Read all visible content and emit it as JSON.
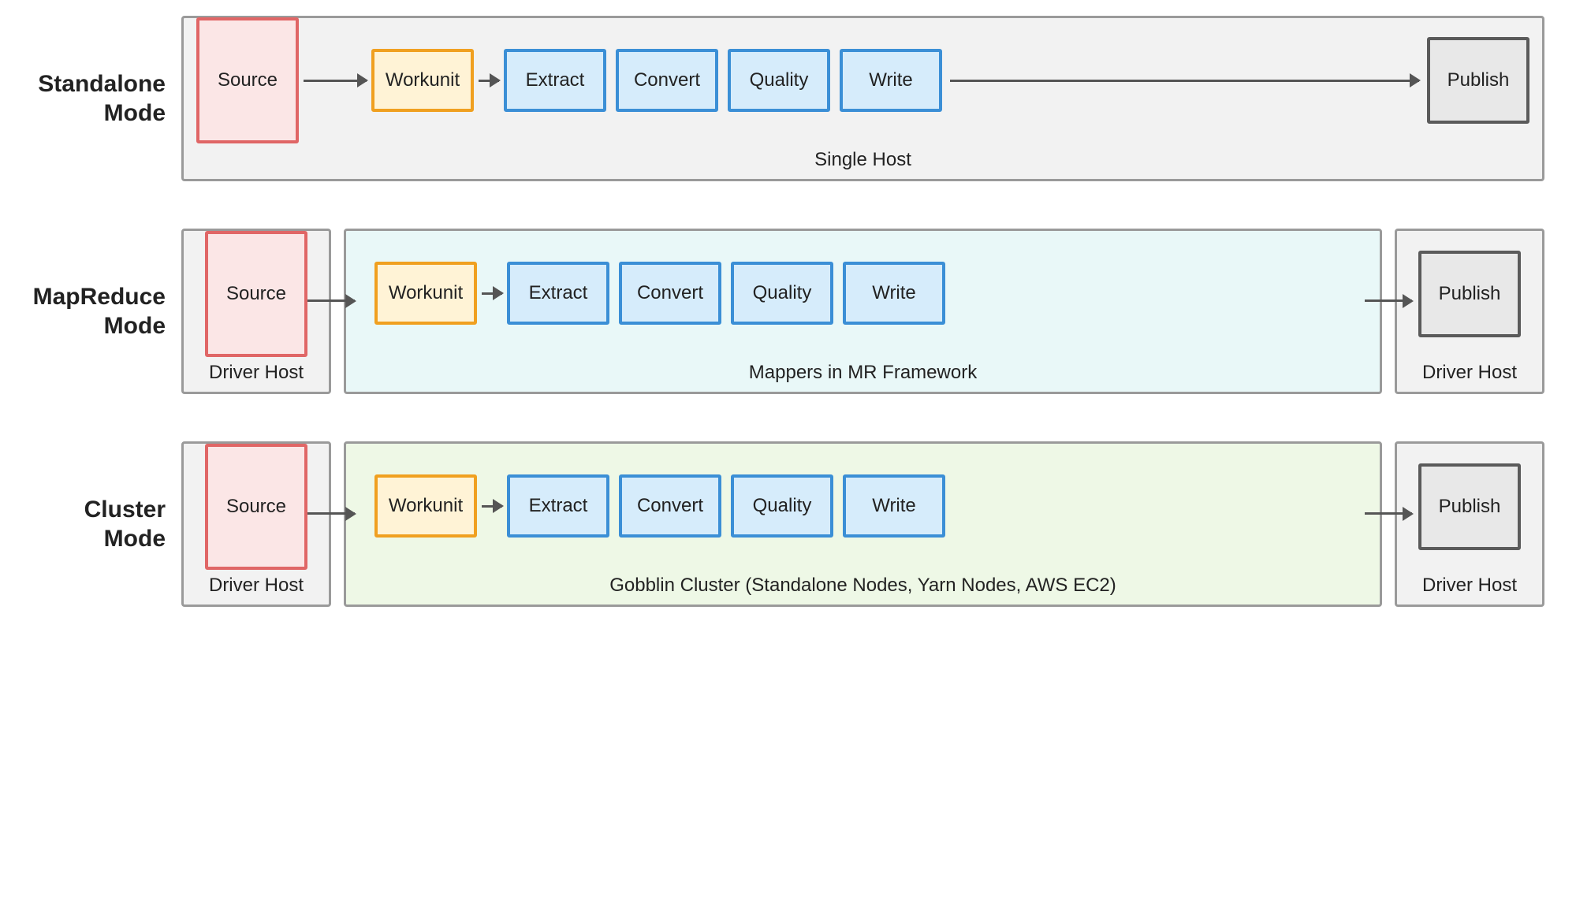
{
  "modes": {
    "standalone": {
      "label": "Standalone\nMode",
      "container_caption": "Single Host",
      "source": "Source",
      "workunit": "Workunit",
      "stages": [
        "Extract",
        "Convert",
        "Quality",
        "Write"
      ],
      "publish": "Publish"
    },
    "mapreduce": {
      "label": "MapReduce\nMode",
      "driver_left_caption": "Driver Host",
      "mappers_caption": "Mappers in MR Framework",
      "driver_right_caption": "Driver Host",
      "source": "Source",
      "workunit": "Workunit",
      "stages": [
        "Extract",
        "Convert",
        "Quality",
        "Write"
      ],
      "publish": "Publish"
    },
    "cluster": {
      "label": "Cluster Mode",
      "driver_left_caption": "Driver Host",
      "cluster_caption": "Gobblin Cluster (Standalone Nodes, Yarn Nodes, AWS EC2)",
      "driver_right_caption": "Driver Host",
      "source": "Source",
      "workunit": "Workunit",
      "stages": [
        "Extract",
        "Convert",
        "Quality",
        "Write"
      ],
      "publish": "Publish"
    }
  }
}
